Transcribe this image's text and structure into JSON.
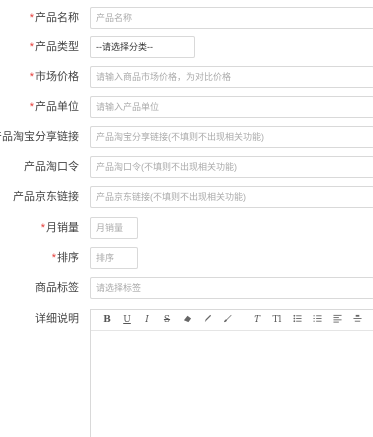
{
  "fields": {
    "product_name": {
      "label": "产品名称",
      "placeholder": "产品名称"
    },
    "product_type": {
      "label": "产品类型",
      "value": "--请选择分类--"
    },
    "market_price": {
      "label": "市场价格",
      "placeholder": "请输入商品市场价格，为对比价格"
    },
    "product_unit": {
      "label": "产品单位",
      "placeholder": "请输入产品单位"
    },
    "taobao_share": {
      "label": "产品淘宝分享链接",
      "placeholder": "产品淘宝分享链接(不填则不出现相关功能)"
    },
    "taobao_code": {
      "label": "产品淘口令",
      "placeholder": "产品淘口令(不填则不出现相关功能)"
    },
    "jd_link": {
      "label": "产品京东链接",
      "placeholder": "产品京东链接(不填则不出现相关功能)"
    },
    "monthly_sales": {
      "label": "月销量",
      "placeholder": "月销量"
    },
    "sort": {
      "label": "排序",
      "placeholder": "排序"
    },
    "tags": {
      "label": "商品标签",
      "placeholder": "请选择标签"
    },
    "description": {
      "label": "详细说明"
    }
  },
  "required_mark": "*",
  "editor_toolbar": {
    "bold": "B",
    "underline": "U",
    "italic": "I",
    "strike": "S",
    "font": "Ƭ",
    "text_size": "Tl"
  },
  "colors": {
    "required": "#e53935",
    "border": "#d9d9d9"
  }
}
